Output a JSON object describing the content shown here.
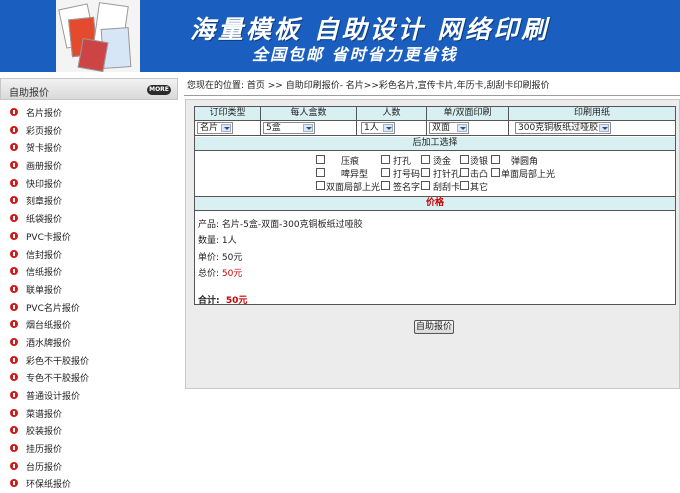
{
  "banner": {
    "title": "海量模板 自助设计 网络印刷",
    "subtitle": "全国包邮  省时省力更省钱"
  },
  "sidebar": {
    "title": "自助报价",
    "more_label": "MORE",
    "items": [
      {
        "label": "名片报价"
      },
      {
        "label": "彩页报价"
      },
      {
        "label": "贺卡报价"
      },
      {
        "label": "画册报价"
      },
      {
        "label": "快印报价"
      },
      {
        "label": "刻章报价"
      },
      {
        "label": "纸袋报价"
      },
      {
        "label": "PVC卡报价"
      },
      {
        "label": "信封报价"
      },
      {
        "label": "信纸报价"
      },
      {
        "label": "联单报价"
      },
      {
        "label": "PVC名片报价"
      },
      {
        "label": "烟台纸报价"
      },
      {
        "label": "酒水牌报价"
      },
      {
        "label": "彩色不干胶报价"
      },
      {
        "label": "专色不干胶报价"
      },
      {
        "label": "普通设计报价"
      },
      {
        "label": "菜谱报价"
      },
      {
        "label": "胶装报价"
      },
      {
        "label": "挂历报价"
      },
      {
        "label": "台历报价"
      },
      {
        "label": "环保纸报价"
      }
    ]
  },
  "breadcrumb": "您现在的位置: 首页 >> 自助印刷报价- 名片>>彩色名片,宣传卡片,年历卡,刮刮卡印刷报价",
  "order": {
    "headers": [
      "订印类型",
      "每人盒数",
      "人数",
      "单/双面印刷",
      "印刷用纸"
    ],
    "selects": [
      "名片",
      "5盒",
      "1人",
      "双面",
      "300克铜板纸过哑胶"
    ],
    "process_header": "后加工选择",
    "process_options": [
      "压痕",
      "打孔",
      "烫金",
      "烫银",
      "弹圆角",
      "啤异型",
      "打号码",
      "打针孔",
      "击凸",
      "单面局部上光",
      "双面局部上光",
      "签名字",
      "刮刮卡",
      "其它"
    ],
    "price_header": "价格",
    "product_label": "产品:",
    "product_value": "名片-5盒-双面-300克铜板纸过哑胶",
    "quantity_label": "数量:",
    "quantity_value": "1人",
    "unit_label": "单价:",
    "unit_value": "50元",
    "total_price_label": "总价:",
    "total_price_value": "50元",
    "sum_label": "合计:",
    "sum_value": "50元",
    "calc_button": "自助报价"
  },
  "colors": {
    "banner": "#1a5fbf",
    "header_cell": "#d9f0f2",
    "accent_red": "#cc0000",
    "bullet": "#cc1b1b"
  }
}
